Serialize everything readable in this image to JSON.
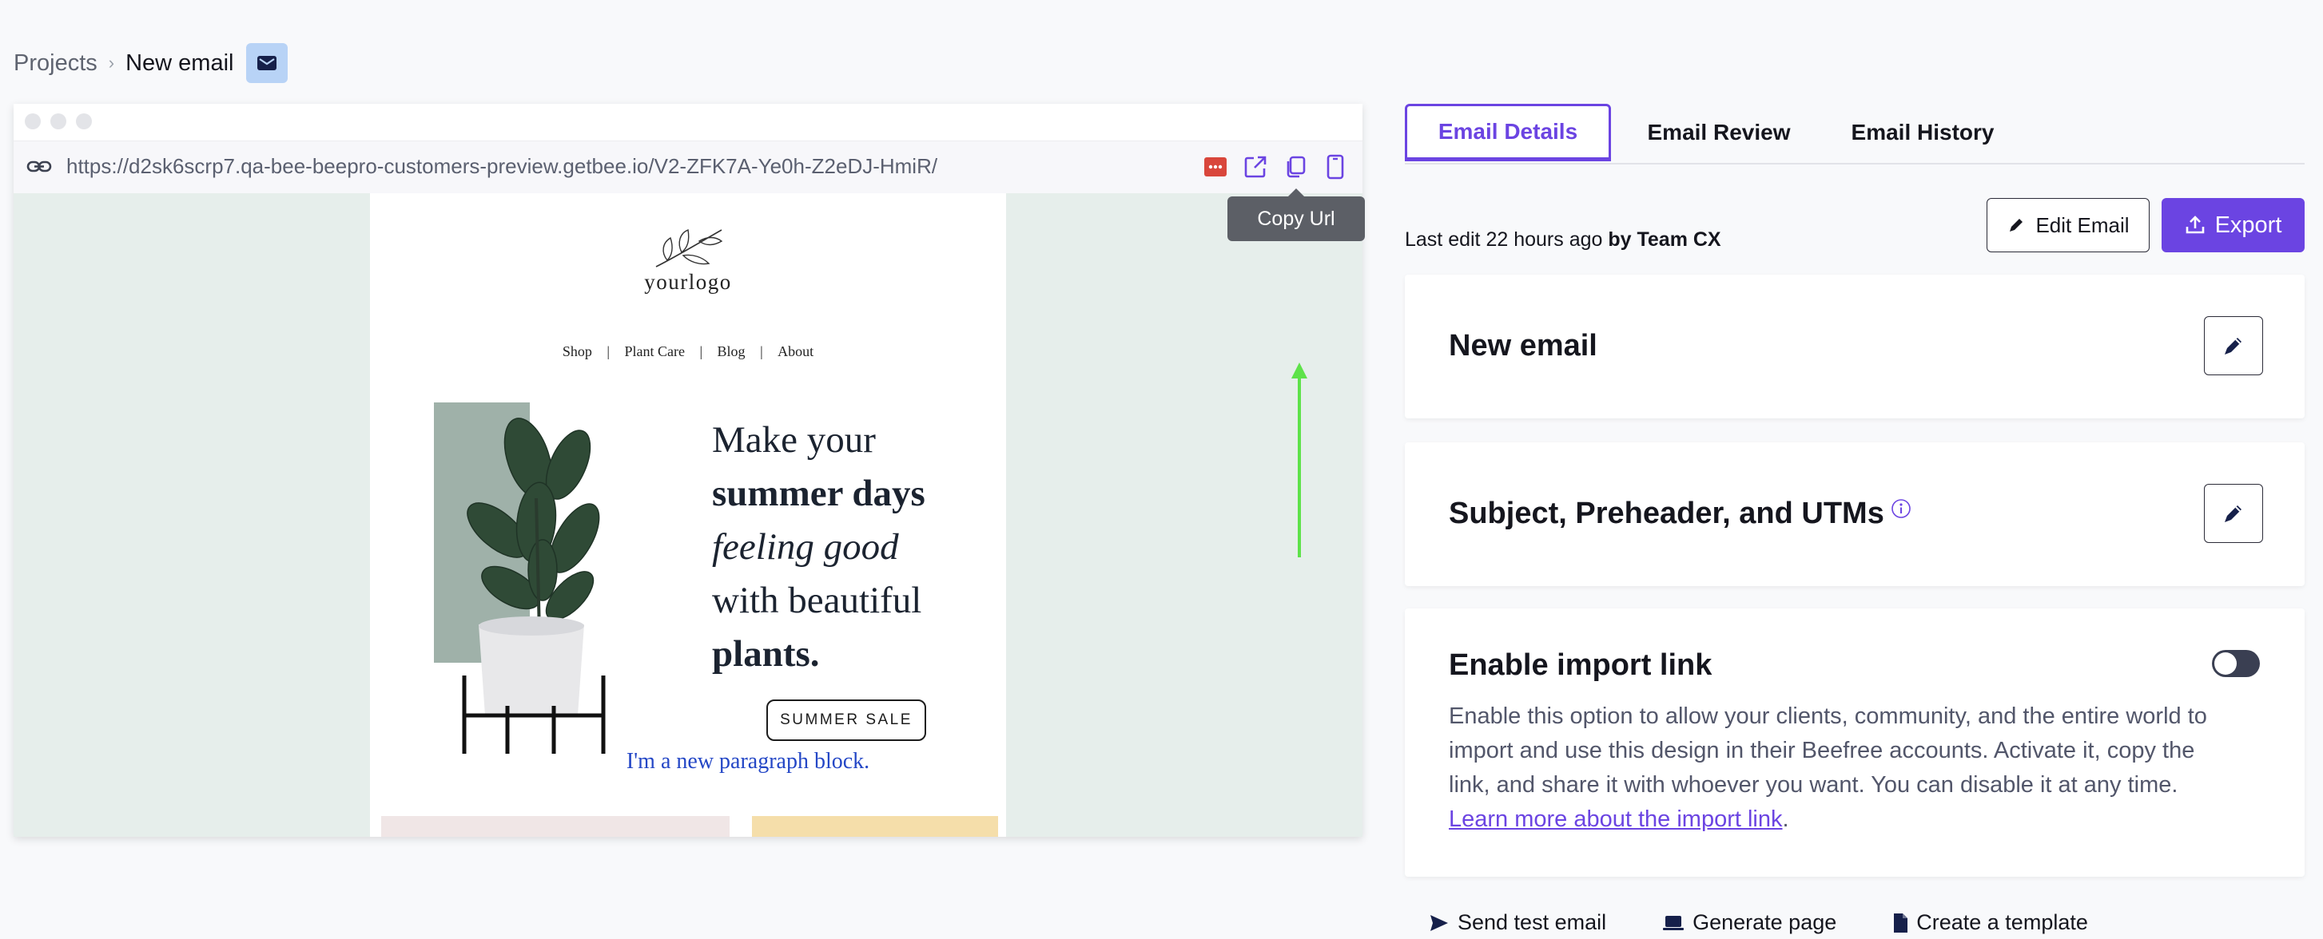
{
  "breadcrumb": {
    "root": "Projects",
    "separator": "›",
    "current": "New email"
  },
  "preview": {
    "url": "https://d2sk6scrp7.qa-bee-beepro-customers-preview.getbee.io/V2-ZFK7A-Ye0h-Z2eDJ-HmiR/",
    "tooltip": "Copy Url",
    "email": {
      "logo": "yourlogo",
      "nav": [
        "Shop",
        "|",
        "Plant Care",
        "|",
        "Blog",
        "|",
        "About"
      ],
      "headline": {
        "line1": "Make your",
        "line2": "summer days",
        "line3": "feeling good",
        "line4": "with beautiful",
        "line5": "plants."
      },
      "cta": "SUMMER SALE",
      "paragraph": "I'm a new paragraph block."
    }
  },
  "tabs": [
    {
      "label": "Email Details",
      "active": true
    },
    {
      "label": "Email Review",
      "active": false
    },
    {
      "label": "Email History",
      "active": false
    }
  ],
  "last_edit": {
    "prefix": "Last edit 22 hours ago",
    "by": "by Team CX"
  },
  "actions": {
    "edit": "Edit Email",
    "export": "Export"
  },
  "cards": {
    "name": {
      "title": "New email"
    },
    "subject": {
      "title": "Subject, Preheader, and UTMs"
    },
    "import": {
      "title": "Enable import link",
      "description": "Enable this option to allow your clients, community, and the entire world to import and use this design in their Beefree accounts. Activate it, copy the link, and share it with whoever you want. You can disable it at any time.",
      "link": "Learn more about the import link",
      "period": ".",
      "enabled": false
    }
  },
  "footer": {
    "send_test": "Send test email",
    "generate_page": "Generate page",
    "create_template": "Create a template"
  },
  "colors": {
    "accent": "#6b44e2",
    "canvas": "#e6eeeb",
    "badge": "#b8d3f6",
    "indicator": "#5ee24a"
  }
}
